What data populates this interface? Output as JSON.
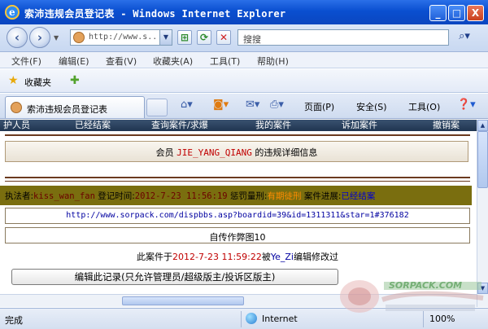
{
  "window": {
    "title": "索沛违规会员登记表 - Windows Internet Explorer",
    "minimize": "_",
    "maximize": "□",
    "close": "X"
  },
  "address": {
    "url": "http://www.s..",
    "search_placeholder": "搜搜"
  },
  "menu": [
    "文件(F)",
    "编辑(E)",
    "查看(V)",
    "收藏夹(A)",
    "工具(T)",
    "帮助(H)"
  ],
  "favorites": {
    "label": "收藏夹"
  },
  "tab": {
    "title": "索沛违规会员登记表"
  },
  "commands": {
    "page": "页面(P)",
    "safety": "安全(S)",
    "tools": "工具(O)"
  },
  "site_nav": [
    "护人员",
    "已经结案",
    "查询案件/求爆",
    "我的案件",
    "诉加案件",
    "撤销案"
  ],
  "record": {
    "header_prefix": "会员",
    "member": "JIE_YANG_QIANG",
    "header_suffix": "的违规详细信息",
    "officer_label": "执法者:",
    "officer": "kiss_wan_fan",
    "time_label": "登记时间:",
    "time": "2012-7-23 11:56:19",
    "penalty_label": "惩罚量刑:",
    "penalty": "有期徒刑",
    "progress_label": "案件进展:",
    "progress": "已经结案",
    "link": "http://www.sorpack.com/dispbbs.asp?boardid=39&id=1311311&star=1#376182",
    "reason": "自传作弊图10",
    "modified_prefix": "此案件于",
    "modified_time": "2012-7-23 11:59:22",
    "modified_by_label": "被",
    "modified_by": "Ye_Zi",
    "modified_suffix": "编辑修改过",
    "edit_button": "编辑此记录(只允许管理员/超级版主/投诉区版主)"
  },
  "status": {
    "text": "完成",
    "zone": "Internet",
    "zoom": "100%"
  },
  "watermark": {
    "text": "SORPACK.COM"
  }
}
